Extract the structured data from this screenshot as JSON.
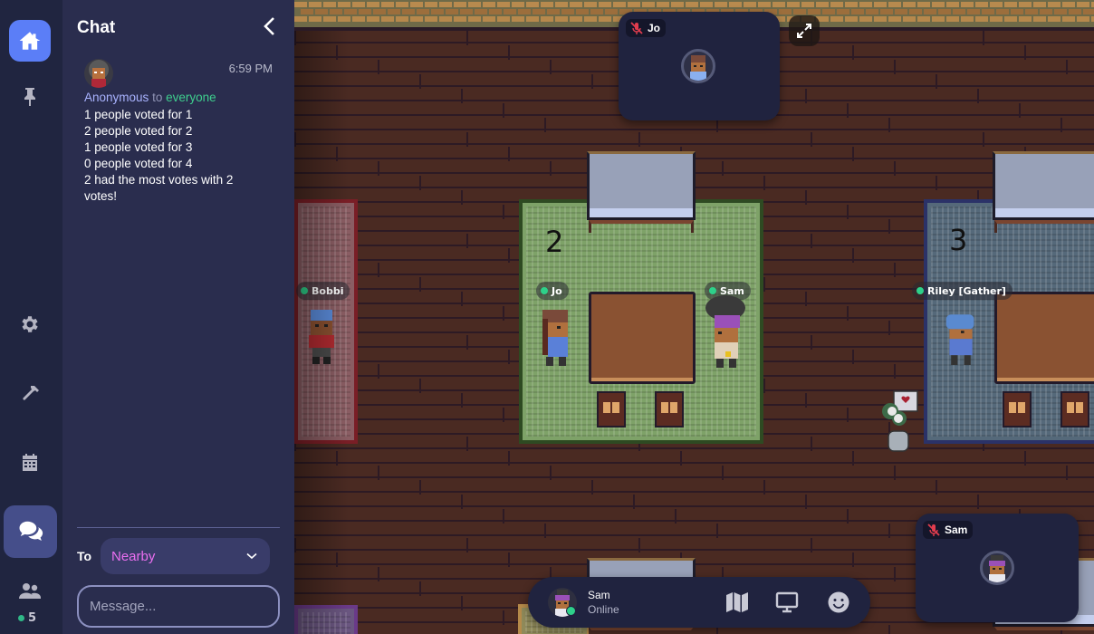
{
  "rail": {
    "items": [
      {
        "name": "home",
        "icon": "home-icon",
        "active": true
      },
      {
        "name": "pin",
        "icon": "pin-icon"
      },
      {
        "name": "settings",
        "icon": "gear-icon"
      },
      {
        "name": "build",
        "icon": "hammer-icon"
      },
      {
        "name": "calendar",
        "icon": "calendar-icon"
      },
      {
        "name": "chat",
        "icon": "chat-bubbles-icon",
        "active": true
      },
      {
        "name": "participants",
        "icon": "users-icon"
      }
    ],
    "online_count": "5",
    "colors": {
      "bg": "#202540",
      "home_active": "#5b7ef7",
      "chat_active": "#454e8a",
      "online_dot": "#2fb887"
    }
  },
  "chat": {
    "title": "Chat",
    "messages": [
      {
        "sender": "Anonymous",
        "to_word": "to",
        "recipient": "everyone",
        "time": "6:59 PM",
        "lines": [
          "1 people voted for 1",
          "2 people voted for 2",
          "1 people voted for 3",
          "0 people voted for 4",
          "2 had the most votes with 2 votes!"
        ]
      }
    ],
    "to_label": "To",
    "to_value": "Nearby",
    "input_placeholder": "Message...",
    "input_value": "",
    "colors": {
      "panel_bg": "#2a2d4e",
      "sender": "#a9b3ff",
      "recipient": "#3ecf8e",
      "to_value": "#ea6ff0"
    }
  },
  "map": {
    "rooms": [
      {
        "id": "red",
        "number": ""
      },
      {
        "id": "green",
        "number": "2"
      },
      {
        "id": "blue",
        "number": "3"
      }
    ],
    "players": [
      {
        "name": "Bobbi",
        "status": "online"
      },
      {
        "name": "Jo",
        "status": "online"
      },
      {
        "name": "Sam",
        "status": "online"
      },
      {
        "name": "Riley [Gather]",
        "status": "online"
      }
    ]
  },
  "video_tiles": [
    {
      "name": "Jo",
      "muted": true
    },
    {
      "name": "Sam",
      "muted": true
    }
  ],
  "bottom_bar": {
    "name": "Sam",
    "status": "Online",
    "buttons": [
      {
        "name": "map",
        "icon": "map-icon"
      },
      {
        "name": "screen-share",
        "icon": "monitor-icon"
      },
      {
        "name": "emote",
        "icon": "smiley-icon"
      }
    ]
  }
}
